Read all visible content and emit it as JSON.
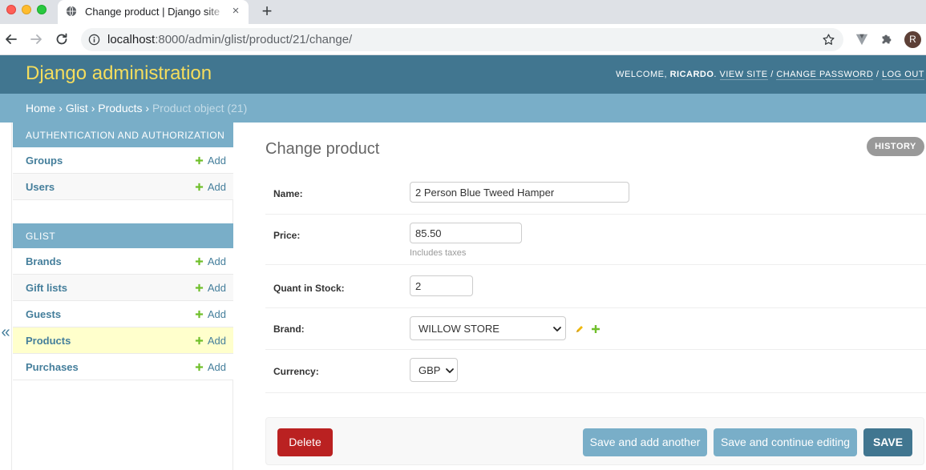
{
  "browser": {
    "tab_title": "Change product | Django site admin",
    "tab_close": "×",
    "new_tab": "+",
    "url_host": "localhost",
    "url_path": ":8000/admin/glist/product/21/change/",
    "profile_initial": "R"
  },
  "header": {
    "branding": "Django administration",
    "welcome": "Welcome, ",
    "username": "Ricardo",
    "links": [
      "View site",
      "Change password",
      "Log out"
    ],
    "sep": " / ",
    "period": "."
  },
  "breadcrumbs": {
    "items": [
      "Home",
      "Glist",
      "Products"
    ],
    "current": "Product object (21)",
    "sep": " › "
  },
  "sidebar": {
    "collapse_glyph": "«",
    "modules": [
      {
        "caption": "AUTHENTICATION AND AUTHORIZATION",
        "models": [
          {
            "name": "Groups",
            "add": "Add"
          },
          {
            "name": "Users",
            "add": "Add"
          }
        ]
      },
      {
        "caption": "GLIST",
        "models": [
          {
            "name": "Brands",
            "add": "Add"
          },
          {
            "name": "Gift lists",
            "add": "Add"
          },
          {
            "name": "Guests",
            "add": "Add"
          },
          {
            "name": "Products",
            "add": "Add"
          },
          {
            "name": "Purchases",
            "add": "Add"
          }
        ]
      }
    ]
  },
  "content": {
    "title": "Change product",
    "history": "HISTORY",
    "fields": {
      "name": {
        "label": "Name:",
        "value": "2 Person Blue Tweed Hamper"
      },
      "price": {
        "label": "Price:",
        "value": "85.50",
        "help": "Includes taxes"
      },
      "quant": {
        "label": "Quant in Stock:",
        "value": "2"
      },
      "brand": {
        "label": "Brand:",
        "value": "WILLOW STORE"
      },
      "currency": {
        "label": "Currency:",
        "value": "GBP"
      }
    },
    "buttons": {
      "delete": "Delete",
      "save_add_another": "Save and add another",
      "save_continue": "Save and continue editing",
      "save": "SAVE"
    }
  },
  "colors": {
    "header_bg": "#417690",
    "branding": "#f5dd5d",
    "module_bg": "#79aec8",
    "link": "#447e9b",
    "delete": "#ba2121",
    "current_row": "#ffffcc",
    "add_plus": "#70bf2b"
  },
  "icons": [
    "globe-icon",
    "back-arrow-icon",
    "forward-arrow-icon",
    "reload-icon",
    "info-icon",
    "star-icon",
    "extension-icon",
    "puzzle-icon",
    "plus-icon",
    "pencil-icon",
    "chevron-down-icon"
  ]
}
